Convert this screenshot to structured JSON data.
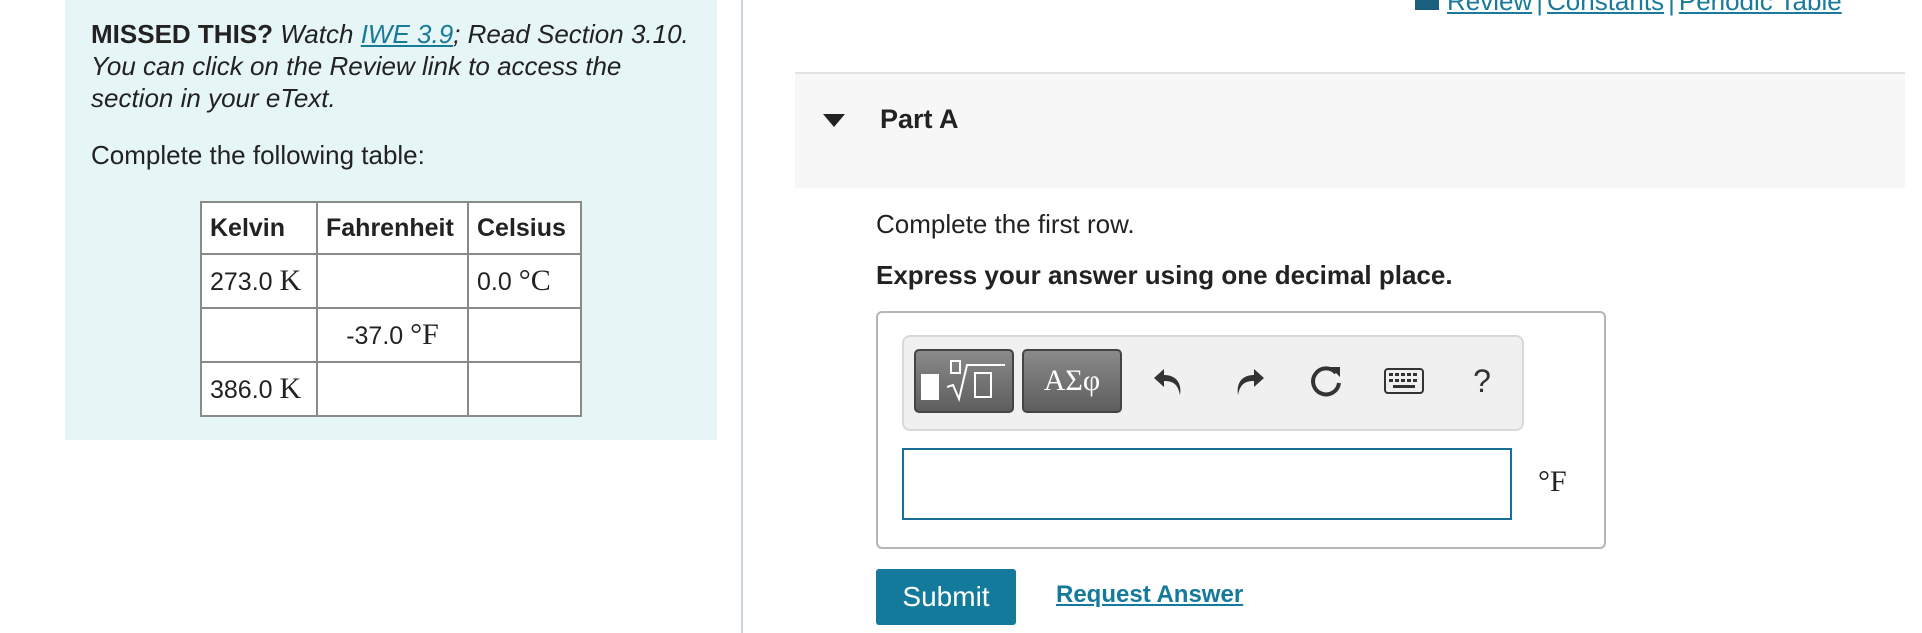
{
  "missed": {
    "heading": "MISSED THIS?",
    "watch_prefix": " Watch ",
    "watch_link": "IWE 3.9",
    "watch_suffix": "; Read Section 3.10. You can click on the Review link to access the section in your eText."
  },
  "instruction": "Complete the following table:",
  "table": {
    "headers": [
      "Kelvin",
      "Fahrenheit",
      "Celsius"
    ],
    "rows": [
      {
        "kelvin": "273.0",
        "kelvin_unit": "K",
        "fahrenheit": "",
        "fahrenheit_unit": "",
        "celsius": "0.0",
        "celsius_unit": "°C"
      },
      {
        "kelvin": "",
        "kelvin_unit": "",
        "fahrenheit": "-37.0",
        "fahrenheit_unit": "°F",
        "celsius": "",
        "celsius_unit": ""
      },
      {
        "kelvin": "386.0",
        "kelvin_unit": "K",
        "fahrenheit": "",
        "fahrenheit_unit": "",
        "celsius": "",
        "celsius_unit": ""
      }
    ]
  },
  "toplinks": {
    "review": "Review",
    "constants": "Constants",
    "periodic": "Periodic Table",
    "separator": "|"
  },
  "part": {
    "title": "Part A",
    "question": "Complete the first row.",
    "instruction": "Express your answer using one decimal place."
  },
  "toolbar": {
    "greek_label": "ΑΣφ",
    "help_label": "?",
    "icons": [
      "templates-icon",
      "greek-symbols-icon",
      "undo-icon",
      "redo-icon",
      "reset-icon",
      "keyboard-icon",
      "help-icon"
    ]
  },
  "answer": {
    "value": "",
    "unit": "°F"
  },
  "buttons": {
    "submit": "Submit",
    "request_answer": "Request Answer"
  },
  "colors": {
    "accent": "#147a9c",
    "left_panel_bg": "#e6f5f5"
  }
}
